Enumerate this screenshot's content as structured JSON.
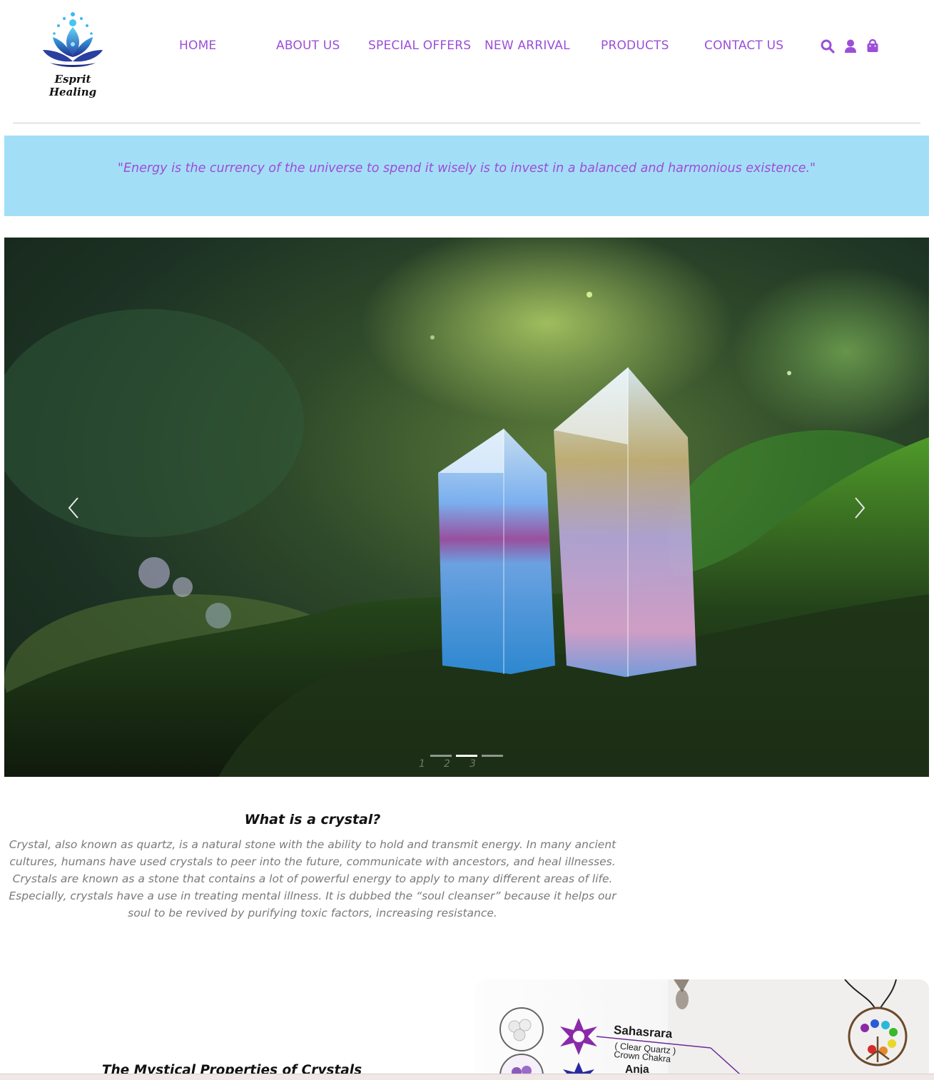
{
  "brand": {
    "name": "Esprit Healing",
    "colors": {
      "accent": "#9b4fd8",
      "quote_band": "#a2dff7",
      "quote_text": "#a04bd9"
    }
  },
  "nav": {
    "items": [
      "HOME",
      "ABOUT US",
      "SPECIAL OFFERS",
      "NEW ARRIVAL",
      "PRODUCTS",
      "CONTACT US"
    ],
    "icons": [
      "search-icon",
      "user-icon",
      "shopping-bag-icon"
    ]
  },
  "quote": {
    "text": "\"Energy is the currency of the universe to spend it wisely is to invest in a balanced and harmonious existence.\""
  },
  "carousel": {
    "indicators": [
      "1",
      "2",
      "3"
    ],
    "active_index": 1,
    "prev_icon": "chevron-left-icon",
    "next_icon": "chevron-right-icon"
  },
  "crystal_section": {
    "title": "What is a crystal?",
    "body": "Crystal, also known as quartz, is a natural stone with the ability to hold and transmit energy. In many ancient cultures, humans have used crystals to peer into the future, communicate with ancestors, and heal illnesses. Crystals are known as a stone that contains a lot of powerful energy to apply to many different areas of life. Especially, crystals have a use in treating mental illness. It is dubbed the “soul cleanser” because it helps our soul to be revived by purifying toxic factors, increasing resistance."
  },
  "mystical_section": {
    "title": "The Mystical Properties of Crystals",
    "chakra_image": {
      "chakras": [
        {
          "name": "Sahasrara",
          "sub1": "( Clear Quartz )",
          "sub2": "Crown Chakra"
        },
        {
          "name": "Anja"
        }
      ]
    }
  }
}
